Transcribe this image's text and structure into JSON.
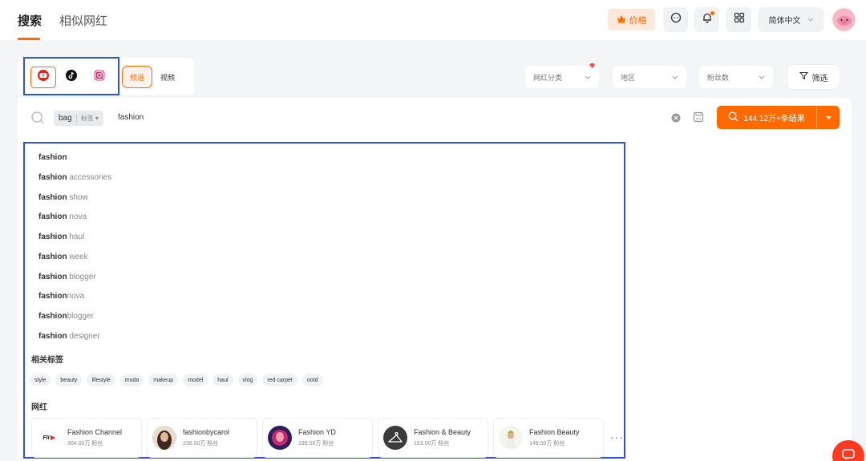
{
  "header": {
    "tabs": [
      {
        "label": "搜索"
      },
      {
        "label": "相似网红"
      }
    ],
    "price_label": "价格",
    "language": "简体中文"
  },
  "filters": {
    "platforms": [
      {
        "name": "youtube-icon",
        "active": true
      },
      {
        "name": "tiktok-icon",
        "active": false
      },
      {
        "name": "instagram-icon",
        "active": false
      }
    ],
    "content_types": [
      {
        "label": "频道"
      },
      {
        "label": "视频"
      }
    ],
    "selects": [
      {
        "label": "网红分类"
      },
      {
        "label": "地区"
      },
      {
        "label": "粉丝数"
      }
    ],
    "filter_button": "筛选"
  },
  "search": {
    "tag_chip": "bag",
    "tag_chip_type": "标签",
    "query": "fashion",
    "result_button": "144.12万+条结果"
  },
  "suggestions": [
    {
      "bold": "fashion",
      "rest": ""
    },
    {
      "bold": "fashion",
      "rest": " accessories"
    },
    {
      "bold": "fashion",
      "rest": " show"
    },
    {
      "bold": "fashion",
      "rest": " nova"
    },
    {
      "bold": "fashion",
      "rest": " haul"
    },
    {
      "bold": "fashion",
      "rest": " week"
    },
    {
      "bold": "fashion",
      "rest": " blogger"
    },
    {
      "bold": "fashion",
      "rest": "nova"
    },
    {
      "bold": "fashion",
      "rest": "blogger"
    },
    {
      "bold": "fashion",
      "rest": " designer"
    }
  ],
  "related_tags": {
    "title": "相关标签",
    "tags": [
      "style",
      "beauty",
      "lifestyle",
      "moda",
      "makeup",
      "model",
      "haul",
      "vlog",
      "red carpet",
      "ootd"
    ]
  },
  "influencers": {
    "title": "网红",
    "items": [
      {
        "name": "Fashion Channel",
        "fans": "304.00万 粉丝",
        "thumb_text": "FII"
      },
      {
        "name": "fashionbycarol",
        "fans": "236.00万 粉丝",
        "thumb_text": ""
      },
      {
        "name": "Fashion YD",
        "fans": "199.00万 粉丝",
        "thumb_text": ""
      },
      {
        "name": "Fashion & Beauty",
        "fans": "153.00万 粉丝",
        "thumb_text": ""
      },
      {
        "name": "Fashion Beauty",
        "fans": "149.00万 粉丝",
        "thumb_text": ""
      }
    ],
    "more": "···"
  },
  "colors": {
    "accent": "#ff6a00",
    "highlight_outline": "#2f54d6"
  }
}
